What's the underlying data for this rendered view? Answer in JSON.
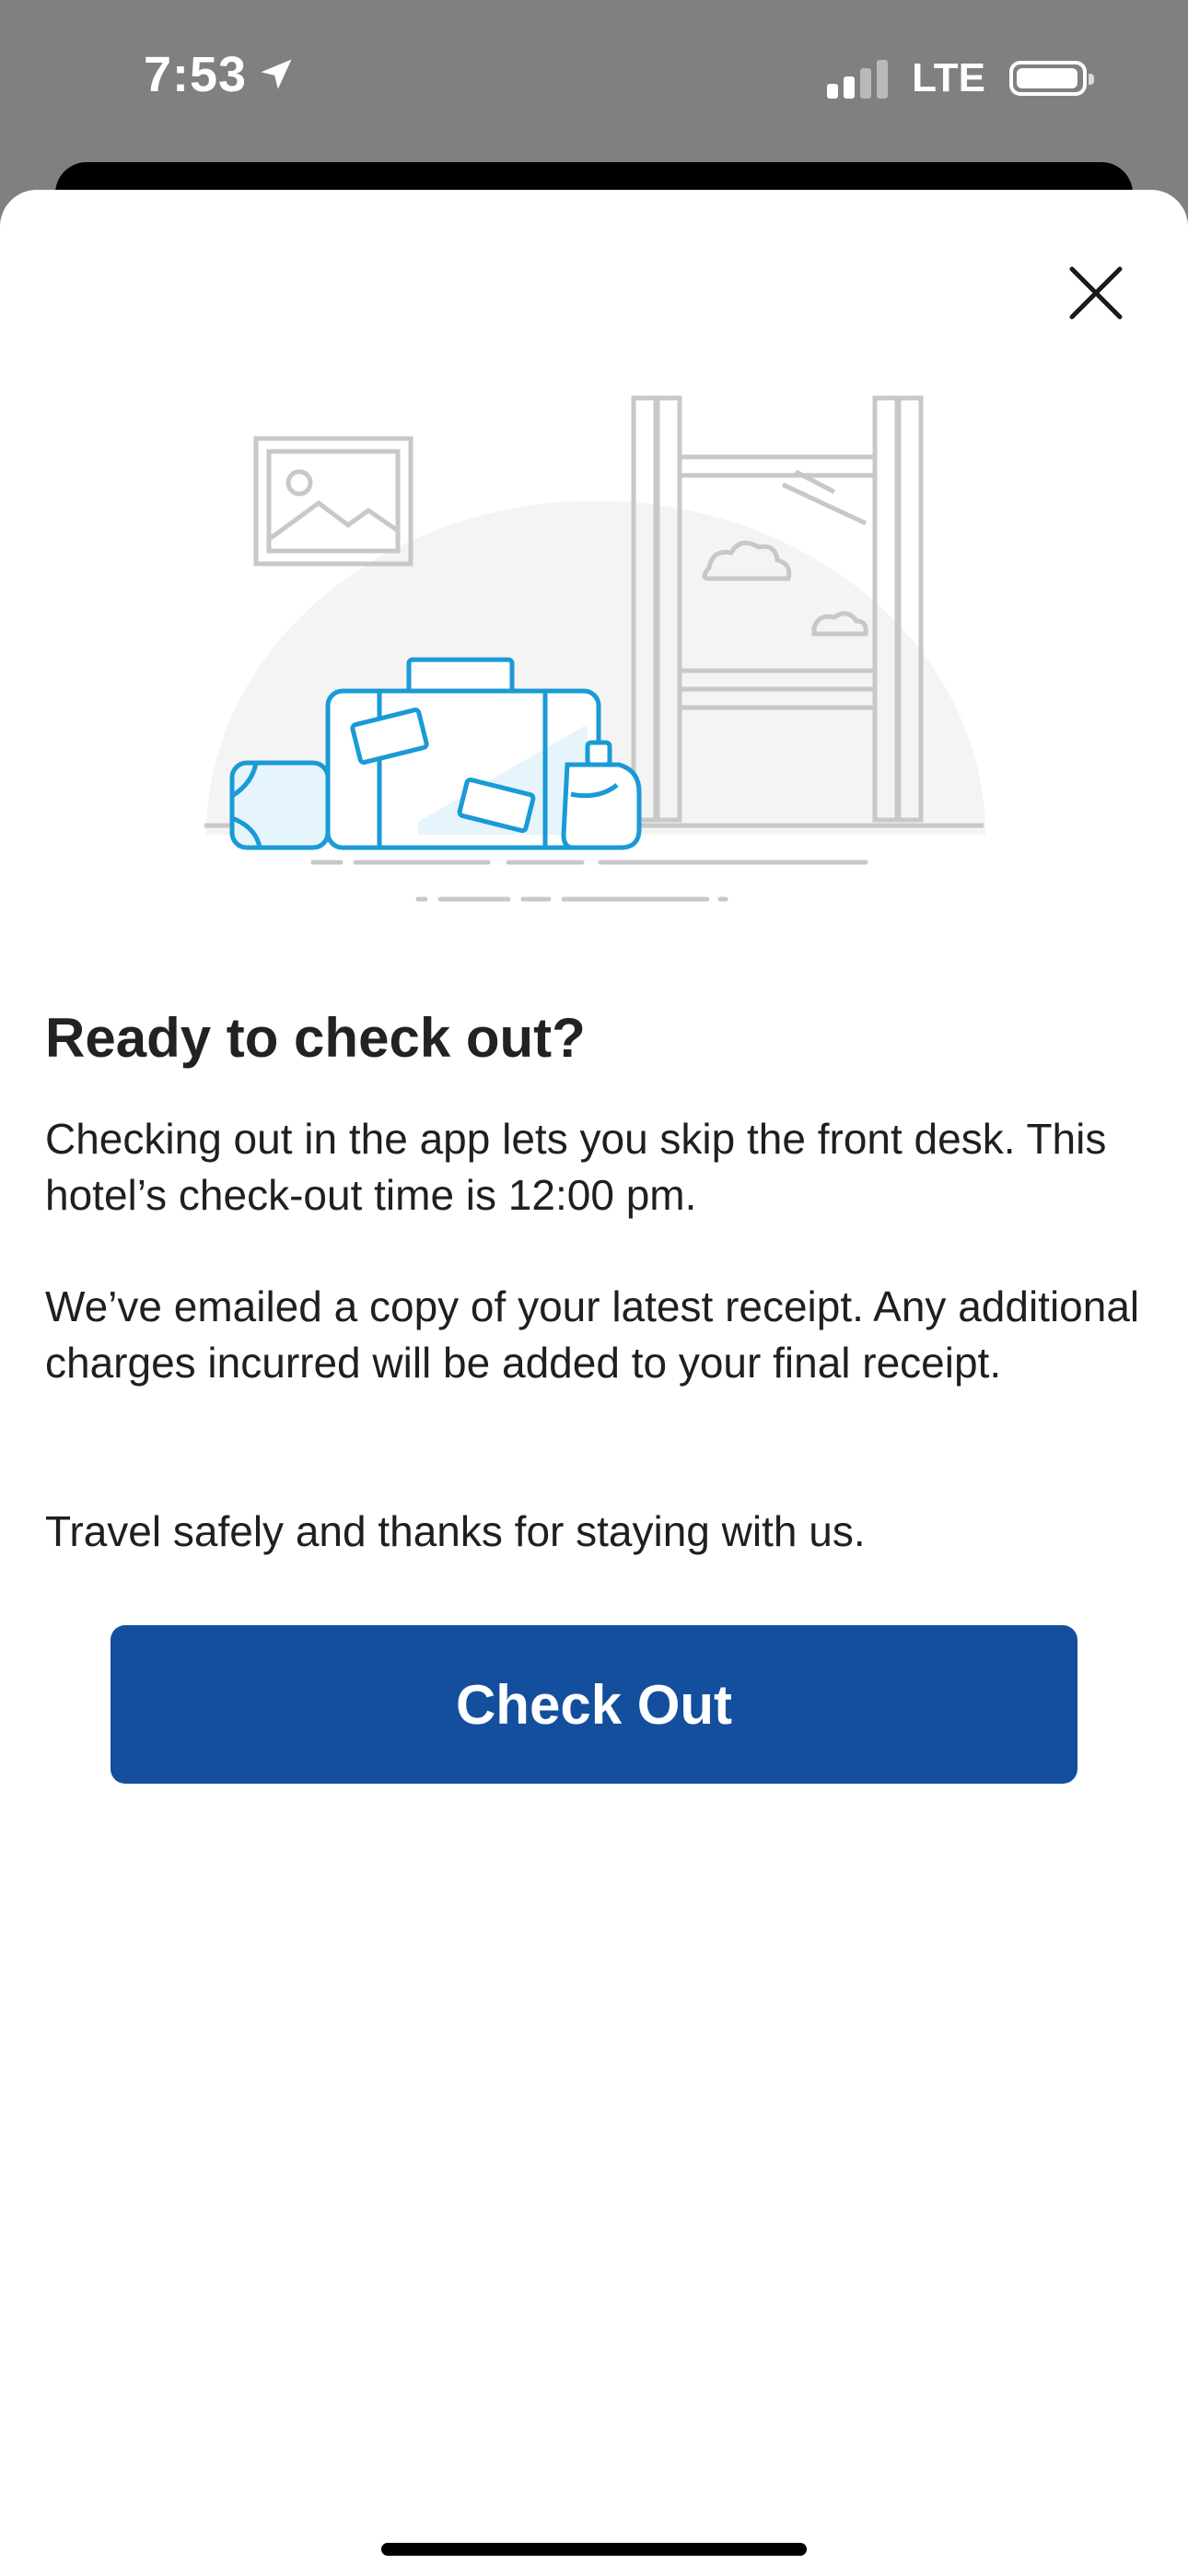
{
  "status_bar": {
    "time": "7:53",
    "network": "LTE",
    "signal_bars_active": 2,
    "signal_bars_total": 4,
    "battery_level": 0.85,
    "icons": [
      "location-arrow-icon",
      "signal-icon",
      "battery-icon"
    ]
  },
  "modal": {
    "close_icon": "close-icon",
    "illustration": "luggage-hotel-window-illustration",
    "title": "Ready to check out?",
    "paragraph_1": "Checking out in the app lets you skip the front desk. This hotel’s check-out time is 12:00 pm.",
    "paragraph_2": "We’ve emailed a copy of your latest receipt. Any additional charges incurred will be added to your final receipt.",
    "paragraph_3": "Travel safely and thanks for staying with us.",
    "button_label": "Check Out"
  },
  "colors": {
    "primary_button": "#134f9c",
    "illustration_accent": "#1a9ad6",
    "illustration_gray": "#c8c8c8",
    "overlay": "#808080"
  }
}
